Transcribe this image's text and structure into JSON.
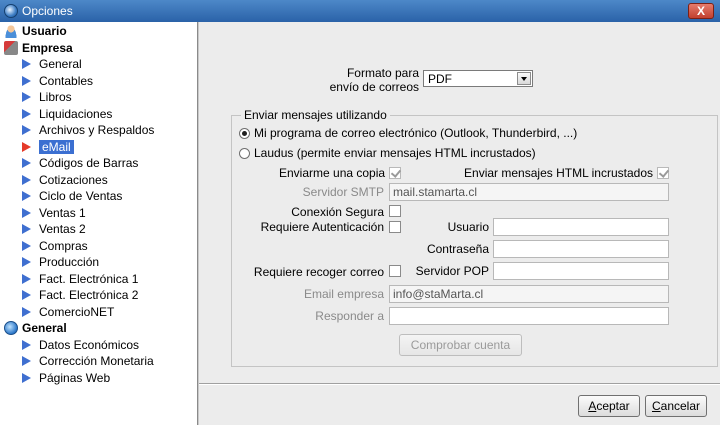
{
  "window": {
    "title": "Opciones",
    "close_label": "X"
  },
  "tree": [
    {
      "label": "Usuario",
      "type": "group",
      "icon": "user-icon"
    },
    {
      "label": "Empresa",
      "type": "group",
      "icon": "company-icon"
    },
    {
      "label": "General",
      "type": "item"
    },
    {
      "label": "Contables",
      "type": "item"
    },
    {
      "label": "Libros",
      "type": "item"
    },
    {
      "label": "Liquidaciones",
      "type": "item"
    },
    {
      "label": "Archivos y Respaldos",
      "type": "item"
    },
    {
      "label": "eMail",
      "type": "item",
      "selected": true
    },
    {
      "label": "Códigos de Barras",
      "type": "item"
    },
    {
      "label": "Cotizaciones",
      "type": "item"
    },
    {
      "label": "Ciclo de Ventas",
      "type": "item"
    },
    {
      "label": "Ventas 1",
      "type": "item"
    },
    {
      "label": "Ventas 2",
      "type": "item"
    },
    {
      "label": "Compras",
      "type": "item"
    },
    {
      "label": "Producción",
      "type": "item"
    },
    {
      "label": "Fact. Electrónica 1",
      "type": "item"
    },
    {
      "label": "Fact. Electrónica 2",
      "type": "item"
    },
    {
      "label": "ComercioNET",
      "type": "item"
    },
    {
      "label": "General",
      "type": "group",
      "icon": "globe-icon"
    },
    {
      "label": "Datos Económicos",
      "type": "item"
    },
    {
      "label": "Corrección Monetaria",
      "type": "item"
    },
    {
      "label": "Páginas Web",
      "type": "item"
    }
  ],
  "email": {
    "format_label_1": "Formato para",
    "format_label_2": "envío de correos",
    "format_value": "PDF",
    "group_title": "Enviar mensajes utilizando",
    "radio_client": "Mi programa de correo electrónico (Outlook, Thunderbird, ...)",
    "radio_laudus": "Laudus (permite enviar mensajes HTML incrustados)",
    "send_copy": "Enviarme una copia",
    "send_html": "Enviar mensajes HTML incrustados",
    "smtp_label": "Servidor SMTP",
    "smtp_value": "mail.stamarta.cl",
    "secure_label": "Conexión Segura",
    "auth_label": "Requiere Autenticación",
    "user_label": "Usuario",
    "password_label": "Contraseña",
    "pop_required_label": "Requiere recoger correo",
    "pop_label": "Servidor POP",
    "company_email_label": "Email empresa",
    "company_email_value": "info@staMarta.cl",
    "reply_label": "Responder a",
    "check_account": "Comprobar cuenta"
  },
  "footer": {
    "accept_label": "Aceptar",
    "cancel_label": "Cancelar"
  }
}
